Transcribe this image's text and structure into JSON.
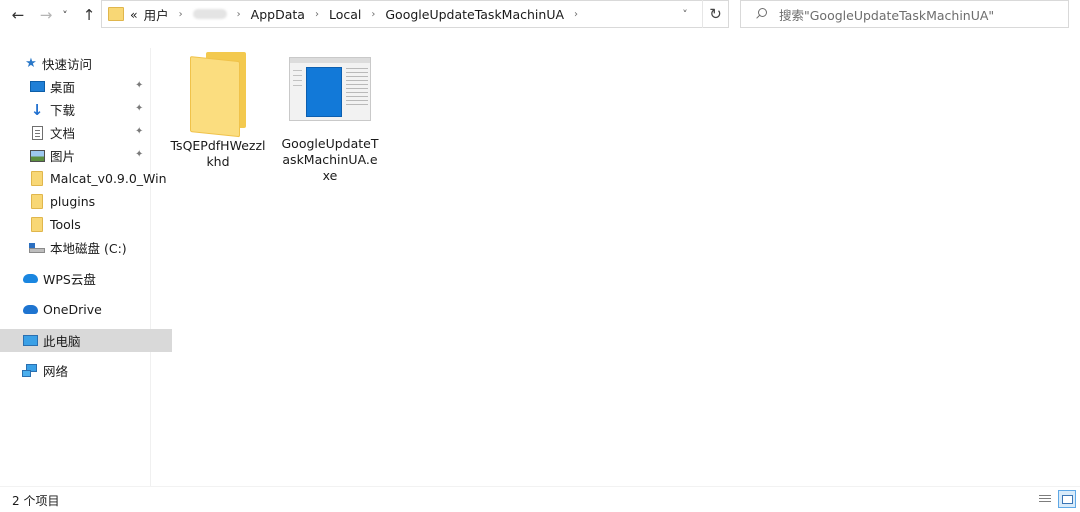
{
  "nav": {
    "back": "←",
    "forward": "→",
    "recent": "˅",
    "up": "↑"
  },
  "address": {
    "overflow": "«",
    "crumbs": [
      "用户",
      "",
      "AppData",
      "Local",
      "GoogleUpdateTaskMachinUA"
    ],
    "separator": "›",
    "dropdown": "˅",
    "refresh": "↻"
  },
  "search": {
    "placeholder": "搜索\"GoogleUpdateTaskMachinUA\""
  },
  "sidebar": {
    "items": [
      {
        "label": "快速访问",
        "icon": "star-icon"
      },
      {
        "label": "桌面",
        "icon": "desktop-icon",
        "pinned": true
      },
      {
        "label": "下载",
        "icon": "download-icon",
        "pinned": true
      },
      {
        "label": "文档",
        "icon": "document-icon",
        "pinned": true
      },
      {
        "label": "图片",
        "icon": "picture-icon",
        "pinned": true
      },
      {
        "label": "Malcat_v0.9.0_Win",
        "icon": "folder-icon"
      },
      {
        "label": "plugins",
        "icon": "folder-icon"
      },
      {
        "label": "Tools",
        "icon": "folder-icon"
      },
      {
        "label": "本地磁盘 (C:)",
        "icon": "drive-icon"
      },
      {
        "label": "WPS云盘",
        "icon": "cloud-icon"
      },
      {
        "label": "OneDrive",
        "icon": "onedrive-icon"
      },
      {
        "label": "此电脑",
        "icon": "computer-icon",
        "selected": true
      },
      {
        "label": "网络",
        "icon": "network-icon"
      }
    ],
    "pin_glyph": "📌"
  },
  "files": [
    {
      "name": "TsQEPdfHWezzlkhd",
      "type": "folder"
    },
    {
      "name": "GoogleUpdateTaskMachinUA.exe",
      "type": "exe"
    }
  ],
  "status": {
    "count": "2 个项目"
  },
  "colors": {
    "selection": "#d9d9d9",
    "folder": "#f8d775",
    "accent": "#1279d8"
  }
}
